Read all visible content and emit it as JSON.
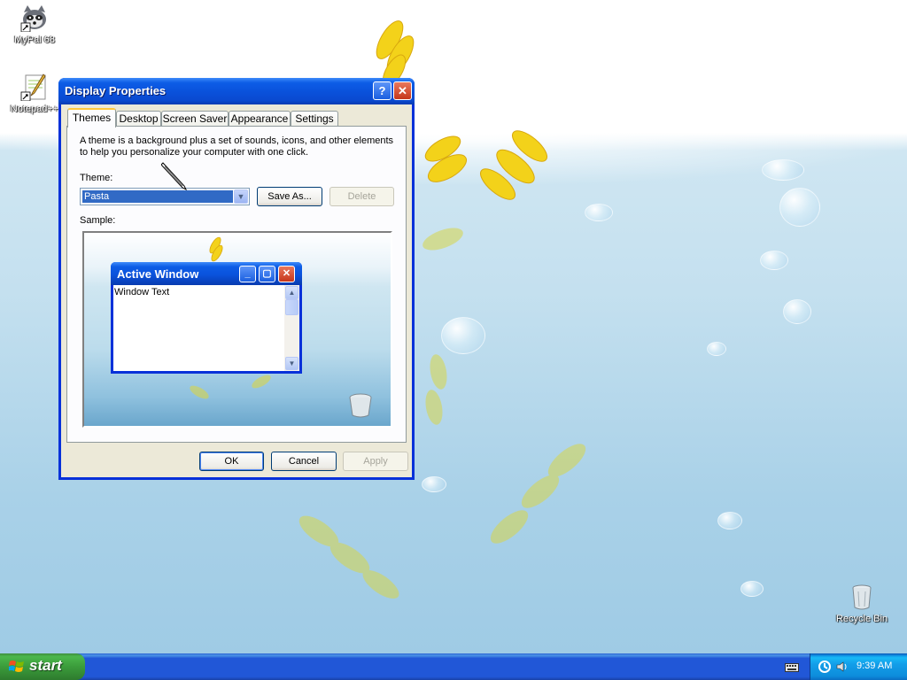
{
  "desktop": {
    "icons": [
      {
        "label": "MyPal 68"
      },
      {
        "label": "Notepad++"
      },
      {
        "label": "Recycle Bin"
      }
    ]
  },
  "dialog": {
    "title": "Display Properties",
    "tabs": [
      "Themes",
      "Desktop",
      "Screen Saver",
      "Appearance",
      "Settings"
    ],
    "active_tab": "Themes",
    "description": "A theme is a background plus a set of sounds, icons, and other elements to help you personalize your computer with one click.",
    "theme_label": "Theme:",
    "theme_value": "Pasta",
    "save_as_label": "Save As...",
    "delete_label": "Delete",
    "sample_label": "Sample:",
    "sample": {
      "window_title": "Active Window",
      "window_text": "Window Text"
    },
    "ok_label": "OK",
    "cancel_label": "Cancel",
    "apply_label": "Apply"
  },
  "taskbar": {
    "start_label": "start",
    "clock": "9:39 AM"
  },
  "colors": {
    "title_blue": "#0a52dc",
    "dialog_face": "#ece9d8",
    "taskbar_blue": "#2157d7",
    "start_green": "#3b9c3b",
    "tab_highlight": "#ffc83c",
    "pasta_yellow": "#f3d21a"
  }
}
